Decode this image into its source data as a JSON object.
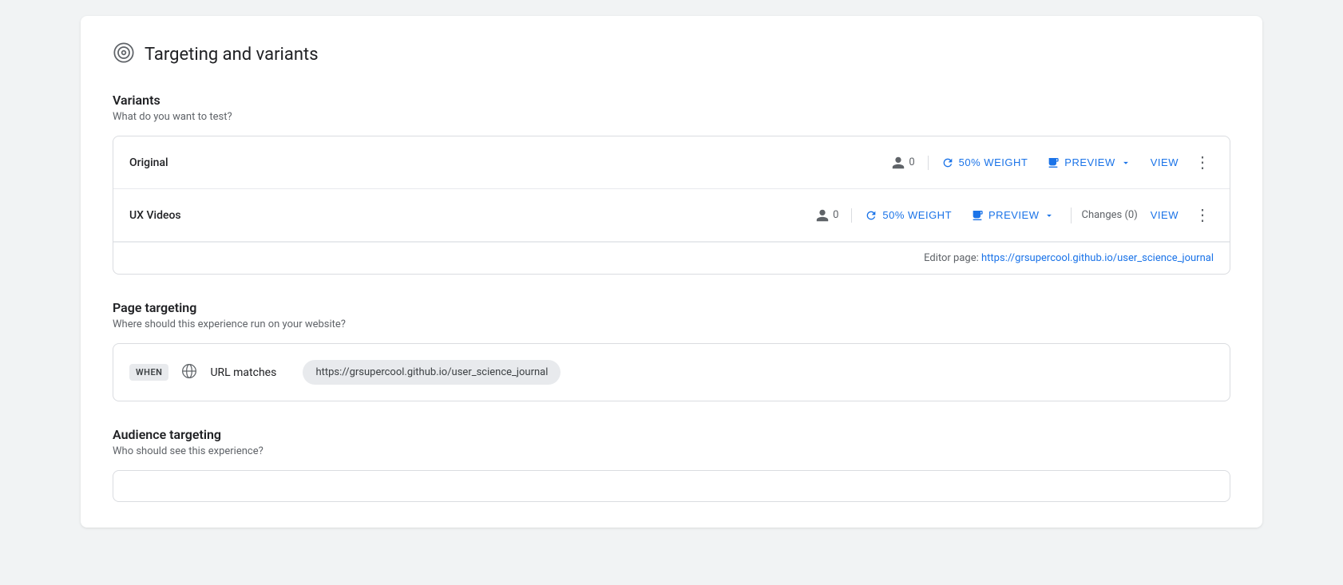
{
  "page": {
    "title": "Targeting and variants"
  },
  "variants_section": {
    "title": "Variants",
    "subtitle": "What do you want to test?",
    "rows": [
      {
        "name": "Original",
        "user_count": "0",
        "weight_label": "50% WEIGHT",
        "preview_label": "PREVIEW",
        "view_label": "VIEW",
        "changes_label": null
      },
      {
        "name": "UX Videos",
        "user_count": "0",
        "weight_label": "50% WEIGHT",
        "preview_label": "PREVIEW",
        "view_label": "VIEW",
        "changes_label": "Changes (0)"
      }
    ],
    "editor_page_label": "Editor page:",
    "editor_page_url": "https://grsupercool.github.io/user_science_journal"
  },
  "page_targeting_section": {
    "title": "Page targeting",
    "subtitle": "Where should this experience run on your website?",
    "when_label": "WHEN",
    "url_matches_label": "URL matches",
    "url_value": "https://grsupercool.github.io/user_science_journal"
  },
  "audience_targeting_section": {
    "title": "Audience targeting",
    "subtitle": "Who should see this experience?"
  }
}
